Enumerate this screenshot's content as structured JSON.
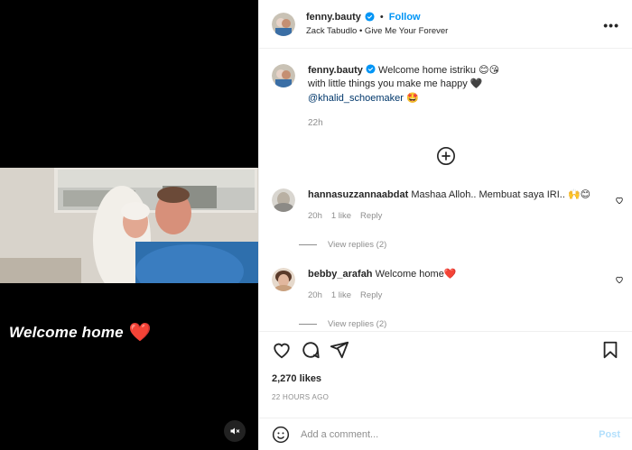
{
  "media": {
    "overlay_text": "Welcome home",
    "overlay_heart": "❤️",
    "mute_icon": "speaker-muted-icon"
  },
  "header": {
    "username": "fenny.bauty",
    "dot": "•",
    "follow_label": "Follow",
    "audio": "Zack Tabudlo • Give Me Your Forever",
    "more_icon": "•••"
  },
  "caption": {
    "username": "fenny.bauty",
    "text_line1": "Welcome home istriku 😊😘",
    "text_line2": "with little things you make me happy 🖤",
    "mention": "@khalid_schoemaker",
    "mention_emoji": "🤩",
    "time": "22h"
  },
  "comments": [
    {
      "username": "hannasuzzannaabdat",
      "text": "Mashaa Alloh.. Membuat saya IRI.. 🙌😊",
      "time": "20h",
      "likes": "1 like",
      "reply": "Reply",
      "view_replies": "View replies (2)"
    },
    {
      "username": "bebby_arafah",
      "text": "Welcome home❤️",
      "time": "20h",
      "likes": "1 like",
      "reply": "Reply",
      "view_replies": "View replies (2)"
    }
  ],
  "likes": "2,270 likes",
  "time_ago": "22 HOURS AGO",
  "add_comment": {
    "placeholder": "Add a comment...",
    "post_label": "Post"
  },
  "colors": {
    "accent": "#0095f6",
    "text": "#262626",
    "muted": "#8e8e8e",
    "heart": "#e8202f"
  }
}
